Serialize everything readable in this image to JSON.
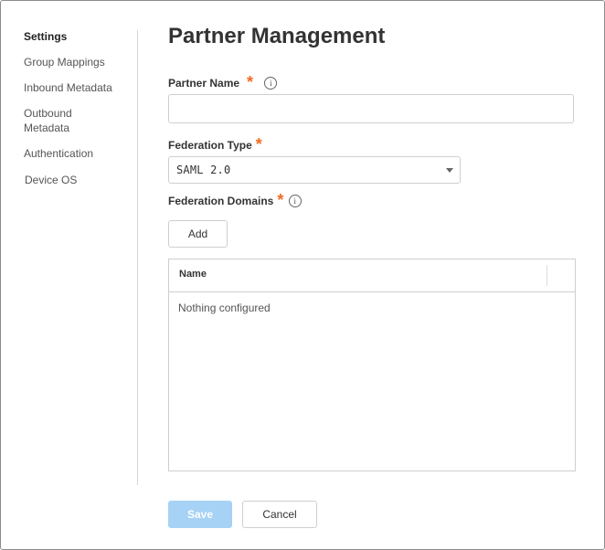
{
  "sidebar": {
    "items": [
      {
        "label": "Settings",
        "active": true
      },
      {
        "label": "Group Mappings"
      },
      {
        "label": "Inbound Metadata"
      },
      {
        "label": "Outbound Metadata"
      },
      {
        "label": "Authentication"
      },
      {
        "label": "Device OS"
      }
    ]
  },
  "page": {
    "title": "Partner Management"
  },
  "form": {
    "partner_name": {
      "label": "Partner Name",
      "required_mark": "*",
      "value": "",
      "info_icon": "info-icon"
    },
    "federation_type": {
      "label": "Federation Type",
      "required_mark": "*",
      "selected": "SAML 2.0"
    },
    "federation_domains": {
      "label": "Federation Domains",
      "required_mark": "*",
      "info_icon": "info-icon",
      "add_label": "Add",
      "table": {
        "columns": [
          "Name"
        ],
        "empty_text": "Nothing configured"
      }
    }
  },
  "actions": {
    "save_label": "Save",
    "cancel_label": "Cancel"
  },
  "colors": {
    "required": "#f26a21",
    "save_button_disabled": "#a6d2f5"
  }
}
